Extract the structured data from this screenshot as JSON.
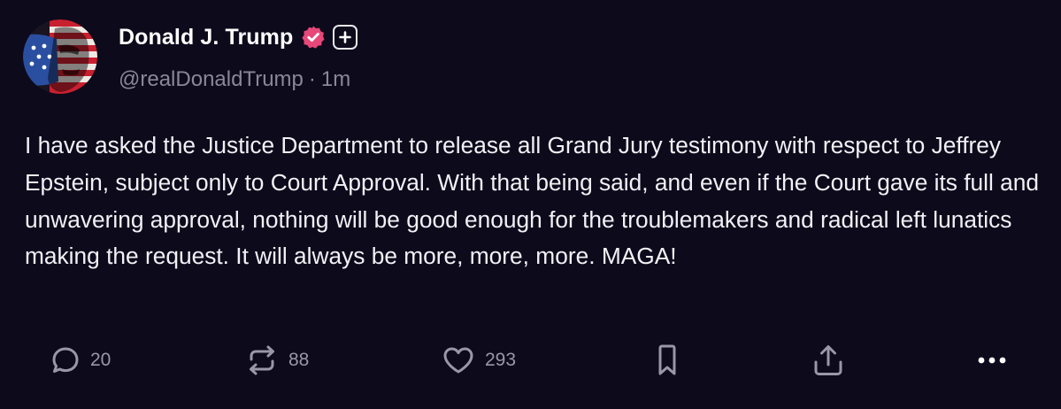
{
  "post": {
    "display_name": "Donald J. Trump",
    "handle": "@realDonaldTrump",
    "separator": "·",
    "time_ago": "1m",
    "verified_icon": "verified-check-icon",
    "plus_icon": "plus-icon",
    "text": "I have asked the Justice Department to release all Grand Jury testimony with respect to Jeffrey Epstein, subject only to Court Approval. With that being said, and even if the Court gave its full and unwavering approval, nothing will be good enough for the troublemakers and radical left lunatics making the request. It will always be more, more, more. MAGA!"
  },
  "actions": {
    "reply_count": "20",
    "repost_count": "88",
    "like_count": "293",
    "icons": [
      "reply-icon",
      "repost-icon",
      "like-icon",
      "bookmark-icon",
      "share-icon",
      "more-icon"
    ]
  },
  "colors": {
    "background": "#0d0a1c",
    "text": "#f2f1f5",
    "muted": "#8a8796",
    "verified_badge": "#e8477a"
  }
}
